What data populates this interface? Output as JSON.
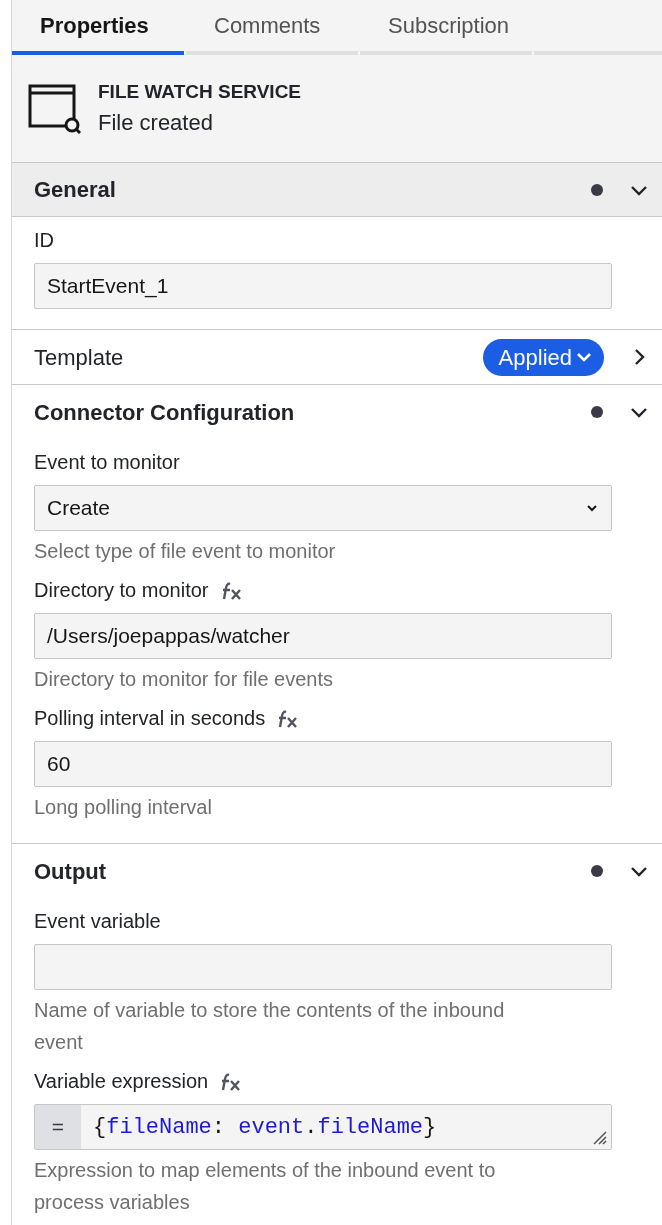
{
  "tabs": [
    {
      "label": "Properties",
      "selected": true
    },
    {
      "label": "Comments",
      "selected": false
    },
    {
      "label": "Subscription",
      "selected": false
    }
  ],
  "element": {
    "type": "FILE WATCH SERVICE",
    "name": "File created"
  },
  "groups": [
    {
      "title": "General",
      "expanded": true,
      "dot": true,
      "highlighted": true,
      "entries": [
        {
          "kind": "text",
          "label": "ID",
          "feel": false,
          "value": "StartEvent_1"
        }
      ]
    },
    {
      "title": "Template",
      "expanded": false,
      "dot": false,
      "highlighted": false,
      "badge": "Applied"
    },
    {
      "title": "Connector Configuration",
      "expanded": true,
      "dot": true,
      "highlighted": false,
      "entries": [
        {
          "kind": "select",
          "label": "Event to monitor",
          "feel": false,
          "value": "Create",
          "description": "Select type of file event to monitor"
        },
        {
          "kind": "text",
          "label": "Directory to monitor",
          "feel": true,
          "value": "/Users/joepappas/watcher",
          "description": "Directory to monitor for file events"
        },
        {
          "kind": "text",
          "label": "Polling interval in seconds",
          "feel": true,
          "value": "60",
          "description": "Long polling interval"
        }
      ]
    },
    {
      "title": "Output",
      "expanded": true,
      "dot": true,
      "highlighted": false,
      "entries": [
        {
          "kind": "text",
          "label": "Event variable",
          "feel": false,
          "description": "Name of variable to store the contents of the inbound event"
        },
        {
          "kind": "code",
          "label": "Variable expression",
          "feel": true,
          "prefix": "=",
          "tokens": [
            {
              "text": "{",
              "kind": "punct"
            },
            {
              "text": "fileName",
              "kind": "name"
            },
            {
              "text": ": ",
              "kind": "punct"
            },
            {
              "text": "event",
              "kind": "name"
            },
            {
              "text": ".",
              "kind": "punct"
            },
            {
              "text": "fileName",
              "kind": "name"
            },
            {
              "text": "}",
              "kind": "punct"
            }
          ],
          "description": "Expression to map elements of the inbound event to process variables"
        }
      ]
    }
  ]
}
